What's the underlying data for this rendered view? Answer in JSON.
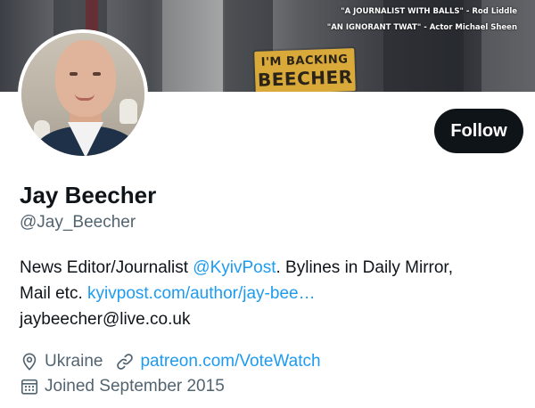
{
  "banner": {
    "quote_1": "\"A JOURNALIST WITH BALLS\" - Rod Liddle",
    "quote_2": "\"AN IGNORANT TWAT\" - Actor Michael Sheen",
    "sign_line_1": "I'M BACKING",
    "sign_line_2": "BEECHER"
  },
  "profile": {
    "name": "Jay Beecher",
    "handle": "@Jay_Beecher",
    "bio": {
      "line1_text": "News Editor/Journalist ",
      "line1_mention": "@KyivPost",
      "line1_after": ". Bylines in Daily Mirror,",
      "line2_text": "Mail etc. ",
      "line2_link": "kyivpost.com/author/jay-bee…",
      "line3_text": "jaybeecher@live.co.uk"
    },
    "location": "Ukraine",
    "website": "patreon.com/VoteWatch",
    "joined": "Joined September 2015"
  },
  "actions": {
    "follow_label": "Follow"
  },
  "icons": {
    "location": "location-pin-icon",
    "website": "link-icon",
    "joined": "calendar-icon"
  },
  "colors": {
    "accent_link": "#1d9bf0",
    "primary_text": "#0f1419",
    "secondary_text": "#536471",
    "button_bg": "#0f1419",
    "sign": "#d9a93a"
  }
}
